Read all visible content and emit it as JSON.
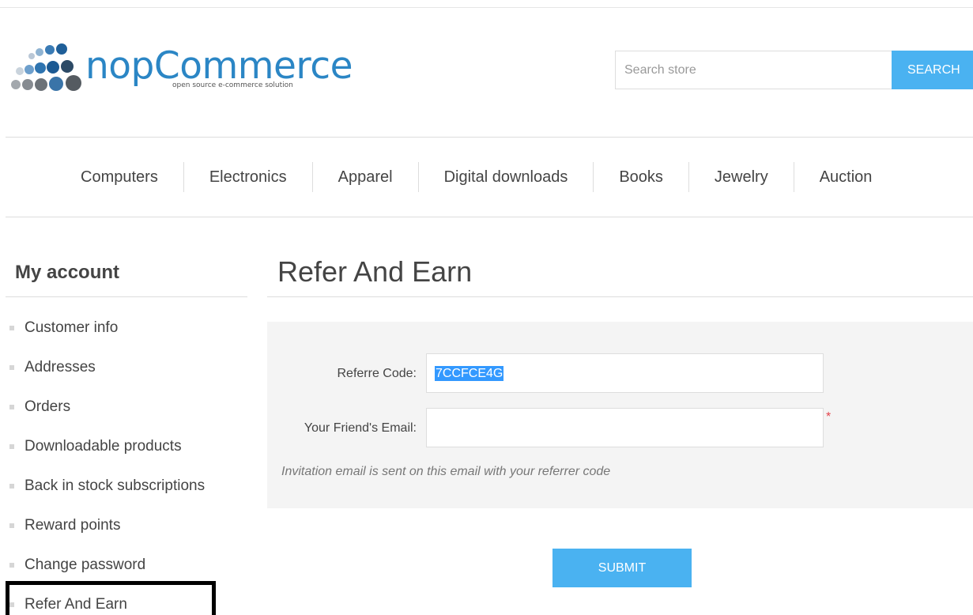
{
  "header": {
    "logo": {
      "name": "nopCommerce",
      "tagline": "open source e-commerce solution"
    },
    "search": {
      "placeholder": "Search store",
      "button_label": "SEARCH"
    }
  },
  "nav": {
    "items": [
      "Computers",
      "Electronics",
      "Apparel",
      "Digital downloads",
      "Books",
      "Jewelry",
      "Auction"
    ]
  },
  "sidebar": {
    "title": "My account",
    "items": [
      "Customer info",
      "Addresses",
      "Orders",
      "Downloadable products",
      "Back in stock subscriptions",
      "Reward points",
      "Change password",
      "Refer And Earn"
    ],
    "active_item": "Refer And Earn"
  },
  "main": {
    "title": "Refer And Earn",
    "form": {
      "referrer_code_label": "Referre Code:",
      "referrer_code_value": "7CCFCE4G",
      "friend_email_label": "Your Friend's Email:",
      "friend_email_value": "",
      "required_mark": "*",
      "hint": "Invitation email is sent on this email with your referrer code"
    },
    "submit_label": "SUBMIT"
  },
  "colors": {
    "brand_blue": "#2b86c5",
    "button_blue": "#4ab2f1",
    "selection_blue": "#3399ff",
    "required_red": "#e4444c",
    "panel_gray": "#f4f4f4"
  }
}
